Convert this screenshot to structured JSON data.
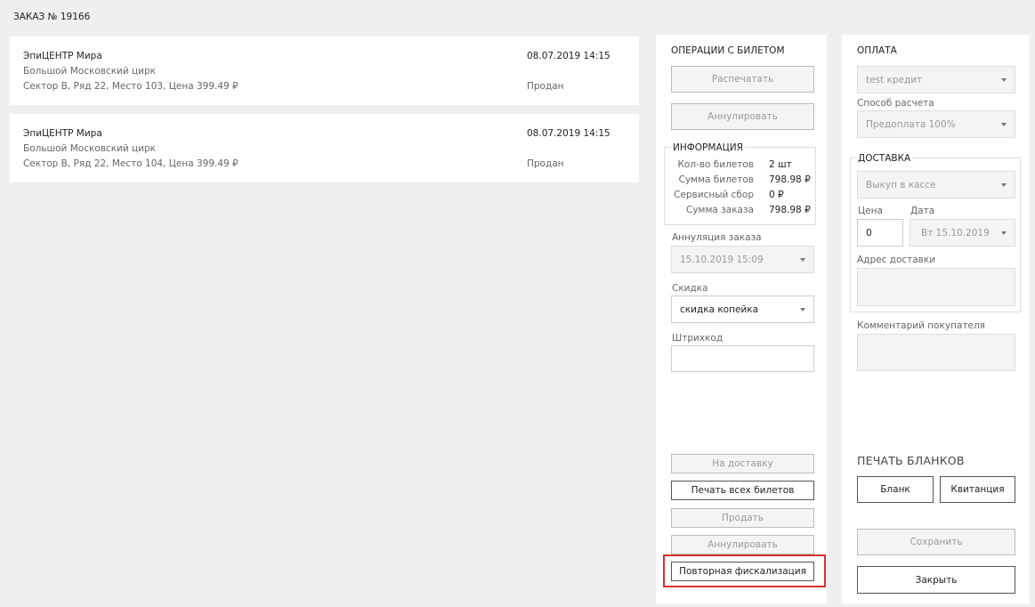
{
  "order": {
    "title": "ЗАКАЗ №  19166"
  },
  "tickets": [
    {
      "name": "ЭпиЦЕНТР Мира",
      "venue": "Большой Московский цирк",
      "seat": "Сектор В, Ряд 22, Место 103, Цена 399.49 ₽",
      "date": "08.07.2019 14:15",
      "status": "Продан"
    },
    {
      "name": "ЭпиЦЕНТР Мира",
      "venue": "Большой Московский цирк",
      "seat": "Сектор В, Ряд 22, Место 104, Цена 399.49 ₽",
      "date": "08.07.2019 14:15",
      "status": "Продан"
    }
  ],
  "operations": {
    "title": "ОПЕРАЦИИ С БИЛЕТОМ",
    "print_button": "Распечатать",
    "cancel_button": "Аннулировать",
    "info": {
      "title": "ИНФОРМАЦИЯ",
      "rows": [
        {
          "key": "Кол-во билетов",
          "value": "2 шт"
        },
        {
          "key": "Сумма билетов",
          "value": "798.98 ₽"
        },
        {
          "key": "Сервисный сбор",
          "value": "0 ₽"
        },
        {
          "key": "Сумма заказа",
          "value": "798.98 ₽"
        }
      ]
    },
    "annulment_label": "Аннуляция заказа",
    "annulment_value": "15.10.2019 15:09",
    "discount_label": "Скидка",
    "discount_value": "скидка копейка",
    "barcode_label": "Штрихкод",
    "barcode_value": "",
    "to_delivery_button": "На доставку",
    "print_all_button": "Печать всех билетов",
    "sell_button": "Продать",
    "annul_button": "Аннулировать",
    "refiscalize_button": "Повторная фискализация"
  },
  "payment": {
    "title": "ОПЛАТА",
    "method_value": "test кредит",
    "calc_label": "Способ расчета",
    "calc_value": "Предоплата 100%",
    "delivery": {
      "title": "ДОСТАВКА",
      "type_value": "Выкуп в кассе",
      "price_label": "Цена",
      "price_value": "0",
      "date_label": "Дата",
      "date_value": "Вт 15.10.2019",
      "address_label": "Адрес доставки",
      "address_value": ""
    },
    "comment_label": "Комментарий покупателя",
    "comment_value": "",
    "print_forms_title": "ПЕЧАТЬ БЛАНКОВ",
    "blank_button": "Бланк",
    "receipt_button": "Квитанция",
    "save_button": "Сохранить",
    "close_button": "Закрыть"
  },
  "colors": {
    "highlight": "#d9302c",
    "background": "#efefef"
  }
}
